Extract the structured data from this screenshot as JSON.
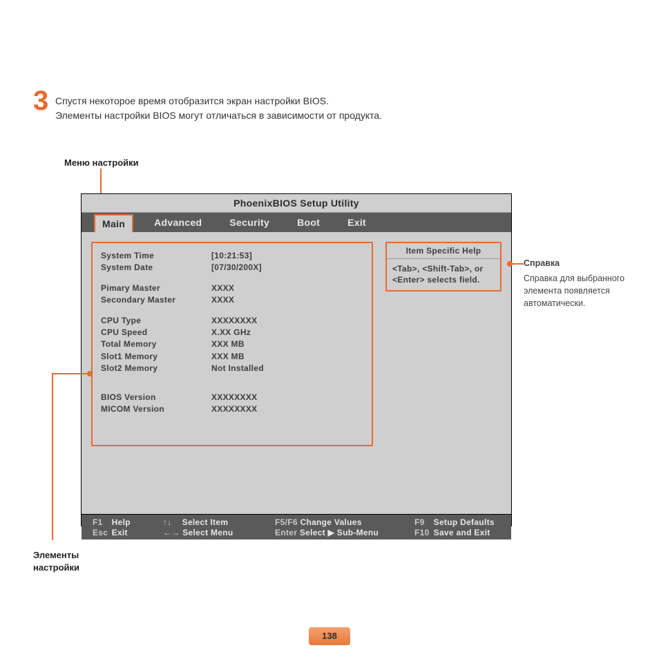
{
  "step": {
    "number": "3",
    "line1": "Спустя некоторое время отобразится экран настройки BIOS.",
    "line2": "Элементы настройки BIOS могут отличаться в зависимости от продукта."
  },
  "labels": {
    "menu": "Меню настройки",
    "elements_l1": "Элементы",
    "elements_l2": "настройки"
  },
  "bios": {
    "title": "PhoenixBIOS Setup Utility",
    "tabs": [
      "Main",
      "Advanced",
      "Security",
      "Boot",
      "Exit"
    ],
    "active_tab": 0,
    "settings": [
      {
        "k": "System Time",
        "v": "[10:21:53]"
      },
      {
        "k": "System Date",
        "v": "[07/30/200X]"
      },
      {
        "gap": true
      },
      {
        "k": "Pimary Master",
        "v": "XXXX"
      },
      {
        "k": "Secondary Master",
        "v": "XXXX"
      },
      {
        "gap": true
      },
      {
        "k": "CPU Type",
        "v": "XXXXXXXX"
      },
      {
        "k": "CPU Speed",
        "v": "X.XX GHz"
      },
      {
        "k": "Total Memory",
        "v": "XXX MB"
      },
      {
        "k": "Slot1 Memory",
        "v": "XXX MB"
      },
      {
        "k": "Slot2 Memory",
        "v": "Not Installed"
      },
      {
        "gap": true
      },
      {
        "gap": true
      },
      {
        "k": "BIOS Version",
        "v": "XXXXXXXX"
      },
      {
        "k": "MICOM Version",
        "v": "XXXXXXXX"
      }
    ],
    "help": {
      "title": "Item Specific Help",
      "body": "<Tab>, <Shift-Tab>, or <Enter> selects field."
    },
    "footer": {
      "c1": [
        [
          "F1",
          "Help"
        ],
        [
          "Esc",
          "Exit"
        ]
      ],
      "c2": [
        [
          "↑↓",
          "Select Item"
        ],
        [
          "←→",
          "Select Menu"
        ]
      ],
      "c3": [
        [
          "F5/F6",
          "Change Values"
        ],
        [
          "Enter",
          "Select ▶ Sub-Menu"
        ]
      ],
      "c4": [
        [
          "F9",
          "Setup Defaults"
        ],
        [
          "F10",
          "Save and Exit"
        ]
      ]
    }
  },
  "side_note": {
    "title": "Справка",
    "body": "Справка для выбранного элемента появляется автоматически."
  },
  "page_number": "138"
}
